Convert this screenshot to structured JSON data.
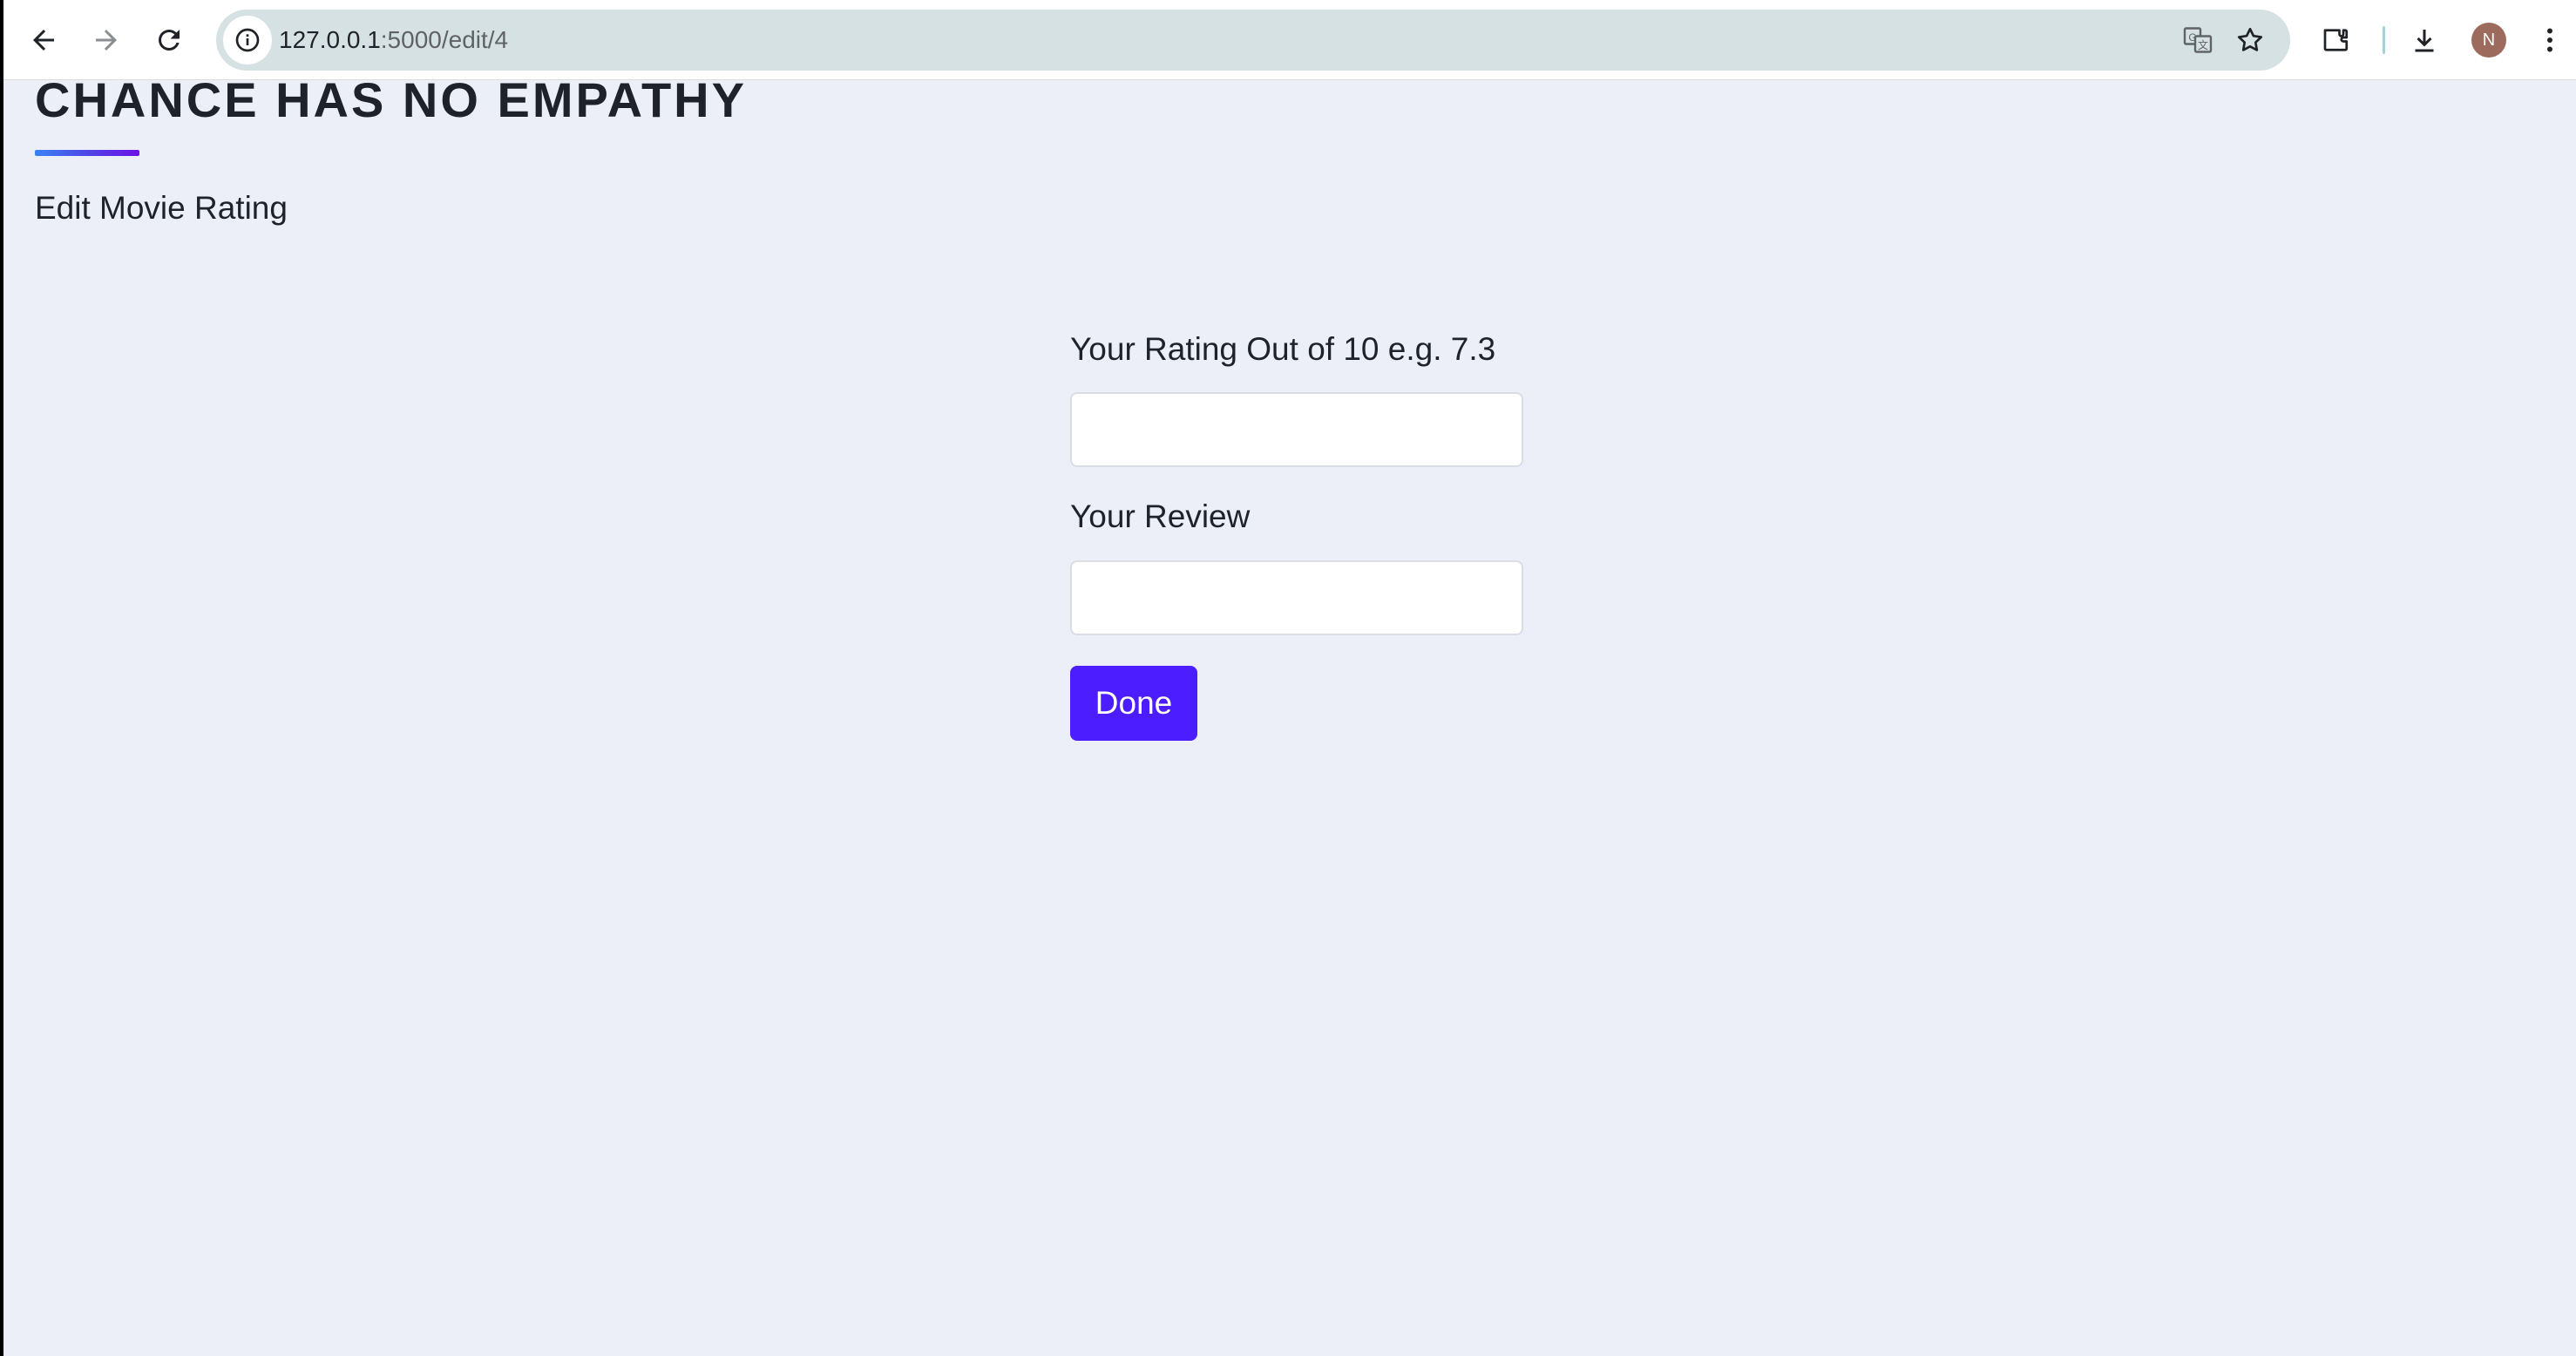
{
  "browser": {
    "url_host": "127.0.0.1",
    "url_path": ":5000/edit/4",
    "profile_initial": "N",
    "icons": {
      "back": "arrow-left-icon",
      "forward": "arrow-right-icon",
      "reload": "reload-icon",
      "site_info": "info-circle-icon",
      "translate": "translate-icon",
      "bookmark": "star-icon",
      "extensions": "puzzle-icon",
      "downloads": "download-icon",
      "menu": "kebab-menu-icon"
    }
  },
  "page": {
    "title": "CHANCE HAS NO EMPATHY",
    "subtitle": "Edit Movie Rating",
    "accent_gradient": [
      "#3b82f6",
      "#4f46e5",
      "#6d11e8"
    ]
  },
  "form": {
    "rating_label": "Your Rating Out of 10 e.g. 7.3",
    "rating_value": "",
    "review_label": "Your Review",
    "review_value": "",
    "submit_label": "Done",
    "submit_color": "#4b1dff"
  }
}
